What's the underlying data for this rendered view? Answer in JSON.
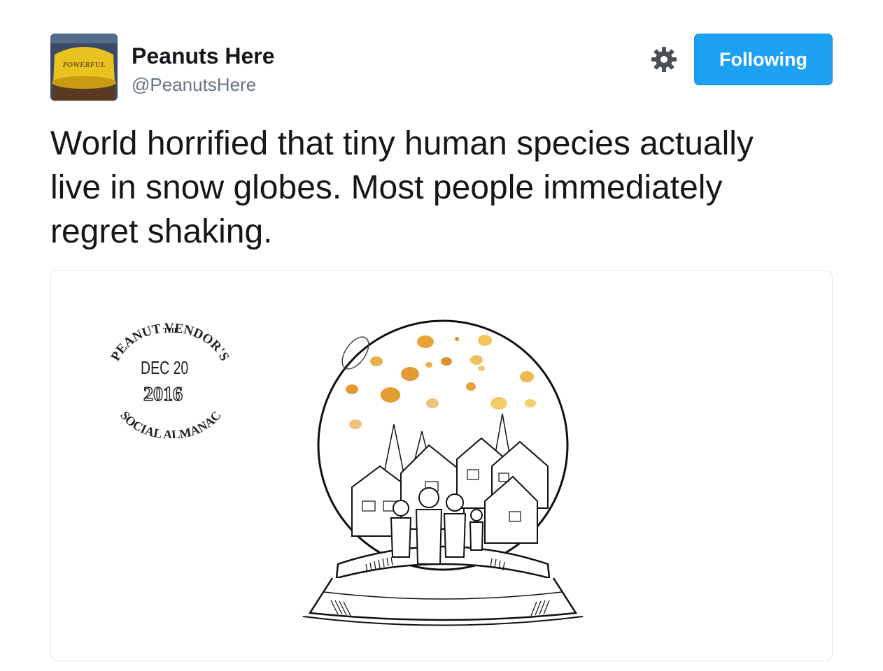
{
  "user": {
    "display_name": "Peanuts Here",
    "handle": "@PeanutsHere",
    "avatar_icon": "peanut-cap-avatar"
  },
  "actions": {
    "settings_icon": "gear-icon",
    "follow_label": "Following",
    "accent_color": "#1da1f2"
  },
  "tweet": {
    "lines": [
      "World horrified that tiny human species actually",
      "live in snow globes. Most people immediately",
      "regret shaking."
    ]
  },
  "media": {
    "stamp": {
      "the": "THE",
      "top_arc": "PEANUT VENDOR'S",
      "date": "DEC 20",
      "year": "2016",
      "bottom_arc": "SOCIAL ALMANAC"
    },
    "avatar_text": "POWERFUL"
  }
}
